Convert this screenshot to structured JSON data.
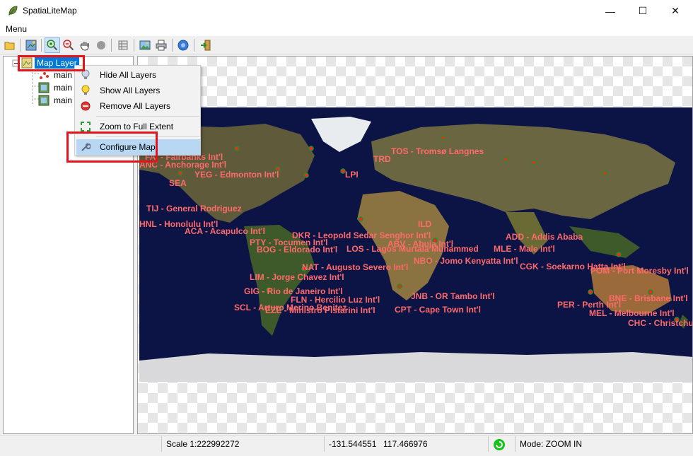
{
  "window": {
    "title": "SpatiaLiteMap",
    "min_glyph": "—",
    "max_glyph": "☐",
    "close_glyph": "✕"
  },
  "menubar": {
    "menu_label": "Menu"
  },
  "toolbar": {
    "buttons": [
      "open-icon",
      "add-layer-icon",
      "zoom-in-icon",
      "zoom-out-icon",
      "pan-icon",
      "identify-icon",
      "table-icon",
      "export-image-icon",
      "print-icon",
      "info-icon",
      "exit-icon"
    ]
  },
  "tree": {
    "root_label": "Map Layer",
    "children": [
      "main",
      "main",
      "main"
    ]
  },
  "context_menu": {
    "items": [
      {
        "label": "Hide All Layers",
        "icon": "lightbulb-off-icon"
      },
      {
        "label": "Show All Layers",
        "icon": "lightbulb-on-icon"
      },
      {
        "label": "Remove All Layers",
        "icon": "remove-icon"
      },
      {
        "label": "Zoom to Full Extent",
        "icon": "full-extent-icon"
      },
      {
        "label": "Configure Map",
        "icon": "wrench-icon"
      }
    ]
  },
  "map": {
    "label_color": "#ff6a6a",
    "airport_labels": [
      "TOS - Tromsø Langnes",
      "FAI - Fairbanks Int'l",
      "ANC - Anchorage Int'l",
      "YEG - Edmonton Int'l",
      "SEA",
      "TIJ - General Rodriguez",
      "HNL - Honolulu Int'l",
      "ACA - Acapulco Int'l",
      "PTY - Tocumen Int'l",
      "BOG - Eldorado Int'l",
      "LOS - Lagos Murtala Muhammed",
      "NBO - Jomo Kenyatta Int'l",
      "NAT - Augusto Severo Int'l",
      "LIM - Jorge Chavez Int'l",
      "GIG - Rio de Janeiro Int'l",
      "FLN - Hercilio Luz Int'l",
      "SCL - Arturo Merino Benitez",
      "EZE - Ministro Pistarini Int'l",
      "CPT - Cape Town Int'l",
      "JNB - OR Tambo Int'l",
      "PER - Perth Int'l",
      "BNE - Brisbane Int'l",
      "MEL - Melbourne Int'l",
      "CHC - Christchurch Int'l",
      "POM - Port Moresby Int'l",
      "CGK - Soekarno Hatta Int'l",
      "MLE - Male Int'l",
      "DKR - Leopold Sedar Senghor Int'l",
      "TRD",
      "LPI",
      "ADD - Addis Ababa",
      "ILD",
      "ABV - Abuja Int'l"
    ]
  },
  "status": {
    "scale": "Scale 1:222992272",
    "x": "-131.544551",
    "y": "117.466976",
    "mode": "Mode: ZOOM IN"
  }
}
